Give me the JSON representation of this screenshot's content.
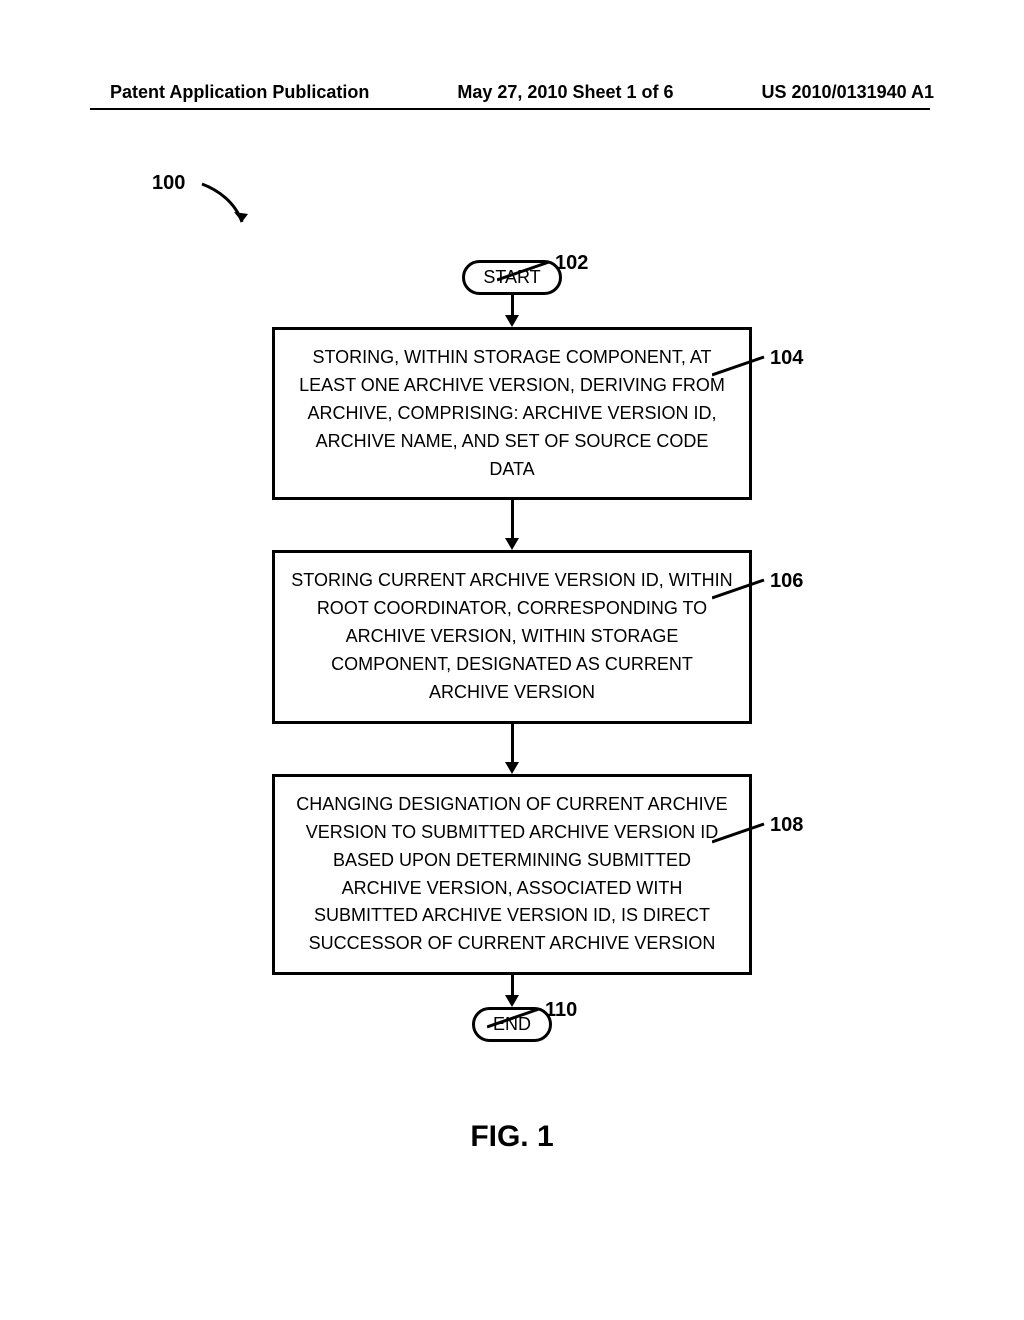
{
  "header": {
    "left": "Patent Application Publication",
    "center": "May 27, 2010  Sheet 1 of 6",
    "right": "US 2010/0131940 A1"
  },
  "refs": {
    "flow_id": "100",
    "start": "102",
    "step1": "104",
    "step2": "106",
    "step3": "108",
    "end": "110"
  },
  "nodes": {
    "start": "START",
    "step1": "STORING, WITHIN STORAGE COMPONENT, AT LEAST ONE ARCHIVE VERSION, DERIVING FROM ARCHIVE, COMPRISING: ARCHIVE VERSION ID, ARCHIVE NAME, AND SET OF SOURCE CODE DATA",
    "step2": "STORING CURRENT ARCHIVE VERSION ID, WITHIN ROOT COORDINATOR, CORRESPONDING TO ARCHIVE VERSION, WITHIN STORAGE COMPONENT, DESIGNATED AS CURRENT ARCHIVE VERSION",
    "step3": "CHANGING DESIGNATION OF CURRENT ARCHIVE VERSION TO SUBMITTED ARCHIVE VERSION ID BASED UPON DETERMINING SUBMITTED ARCHIVE VERSION, ASSOCIATED WITH SUBMITTED ARCHIVE VERSION ID, IS DIRECT SUCCESSOR OF CURRENT ARCHIVE VERSION",
    "end": "END"
  },
  "figure_label": "FIG. 1"
}
